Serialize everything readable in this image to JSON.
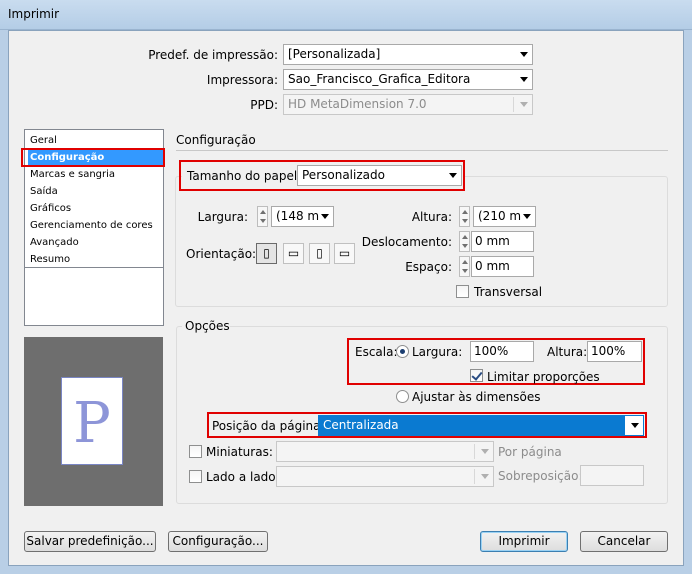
{
  "window": {
    "title": "Imprimir"
  },
  "header": {
    "preset_label": "Predef. de impressão:",
    "preset_value": "[Personalizada]",
    "printer_label": "Impressora:",
    "printer_value": "Sao_Francisco_Grafica_Editora",
    "ppd_label": "PPD:",
    "ppd_value": "HD MetaDimension 7.0"
  },
  "sidebar": {
    "items": [
      {
        "label": "Geral"
      },
      {
        "label": "Configuração"
      },
      {
        "label": "Marcas e sangria"
      },
      {
        "label": "Saída"
      },
      {
        "label": "Gráficos"
      },
      {
        "label": "Gerenciamento de cores"
      },
      {
        "label": "Avançado"
      },
      {
        "label": "Resumo"
      }
    ],
    "selected_index": 1,
    "preview_letter": "P"
  },
  "config": {
    "section_title": "Configuração",
    "paper_size_label": "Tamanho do papel:",
    "paper_size_value": "Personalizado",
    "width_label": "Largura:",
    "width_value": "(148 m",
    "height_label": "Altura:",
    "height_value": "(210 m",
    "offset_label": "Deslocamento:",
    "offset_value": "0 mm",
    "gap_label": "Espaço:",
    "gap_value": "0 mm",
    "orientation_label": "Orientação:",
    "transverse_label": "Transversal"
  },
  "options": {
    "section_title": "Opções",
    "scale_label": "Escala:",
    "scale_width_label": "Largura:",
    "scale_width_value": "100%",
    "scale_height_label": "Altura:",
    "scale_height_value": "100%",
    "constrain_label": "Limitar proporções",
    "fit_label": "Ajustar às dimensões",
    "page_position_label": "Posição da página:",
    "page_position_value": "Centralizada",
    "thumbnails_label": "Miniaturas:",
    "per_page_label": "Por página",
    "tile_label": "Lado a lado:",
    "overlap_label": "Sobreposição:"
  },
  "buttons": {
    "save_preset": "Salvar predefinição...",
    "setup": "Configuração...",
    "print": "Imprimir",
    "cancel": "Cancelar"
  }
}
